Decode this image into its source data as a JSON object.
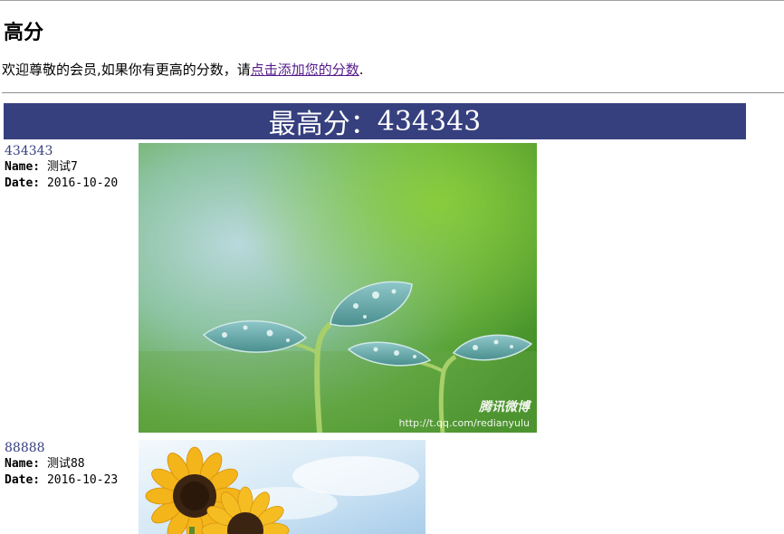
{
  "page": {
    "title": "高分",
    "intro_text": "欢迎尊敬的会员,如果你有更高的分数，请",
    "intro_link": "点击添加您的分数",
    "intro_end": "."
  },
  "banner": {
    "label": "最高分：",
    "value": "434343"
  },
  "field_labels": {
    "name": "Name:",
    "date": "Date:"
  },
  "entries": [
    {
      "score": "434343",
      "name": "测试7",
      "date": "2016-10-20",
      "image": "seedling-with-water-drops",
      "watermark_brand": "腾讯微博",
      "watermark_url": "http://t.qq.com/redianyulu"
    },
    {
      "score": "88888",
      "name": "测试88",
      "date": "2016-10-23",
      "image": "sunflowers-under-sky"
    }
  ],
  "colors": {
    "banner_bg": "#36407e",
    "link_visited": "#551a8b",
    "score_text": "#36407e"
  }
}
